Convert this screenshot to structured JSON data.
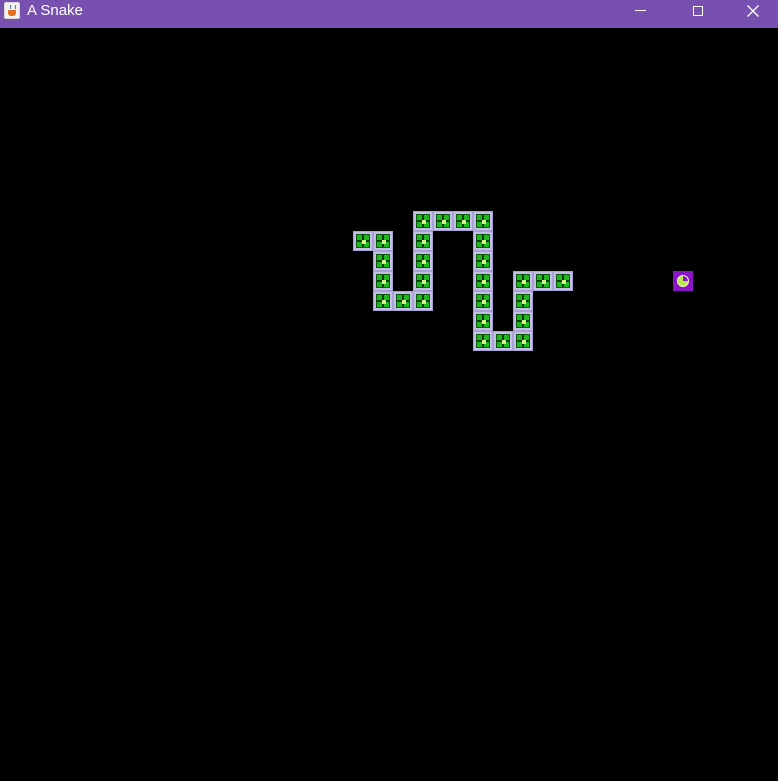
{
  "window": {
    "title": "A Snake",
    "title_bar_color": "#7750b0",
    "app_icon": "java-cup-icon",
    "controls": [
      "minimize-icon",
      "maximize-icon",
      "close-icon"
    ]
  },
  "game": {
    "background_color": "#000000",
    "grid_cell": 20,
    "snake_color": "#1db81d",
    "snake_border_color": "#c4bfe6",
    "food_color": "#8c14c8",
    "snake_segments": [
      {
        "col": 18,
        "row": 11
      },
      {
        "col": 19,
        "row": 11
      },
      {
        "col": 19,
        "row": 12
      },
      {
        "col": 19,
        "row": 13
      },
      {
        "col": 19,
        "row": 14
      },
      {
        "col": 20,
        "row": 14
      },
      {
        "col": 21,
        "row": 14
      },
      {
        "col": 21,
        "row": 13
      },
      {
        "col": 21,
        "row": 12
      },
      {
        "col": 21,
        "row": 11
      },
      {
        "col": 21,
        "row": 10
      },
      {
        "col": 22,
        "row": 10
      },
      {
        "col": 23,
        "row": 10
      },
      {
        "col": 24,
        "row": 10
      },
      {
        "col": 24,
        "row": 11
      },
      {
        "col": 24,
        "row": 12
      },
      {
        "col": 24,
        "row": 13
      },
      {
        "col": 24,
        "row": 14
      },
      {
        "col": 24,
        "row": 15
      },
      {
        "col": 24,
        "row": 16
      },
      {
        "col": 25,
        "row": 16
      },
      {
        "col": 26,
        "row": 16
      },
      {
        "col": 26,
        "row": 15
      },
      {
        "col": 26,
        "row": 14
      },
      {
        "col": 26,
        "row": 13
      },
      {
        "col": 27,
        "row": 13
      },
      {
        "col": 28,
        "row": 13
      }
    ],
    "food": {
      "col": 34,
      "row": 13
    }
  }
}
